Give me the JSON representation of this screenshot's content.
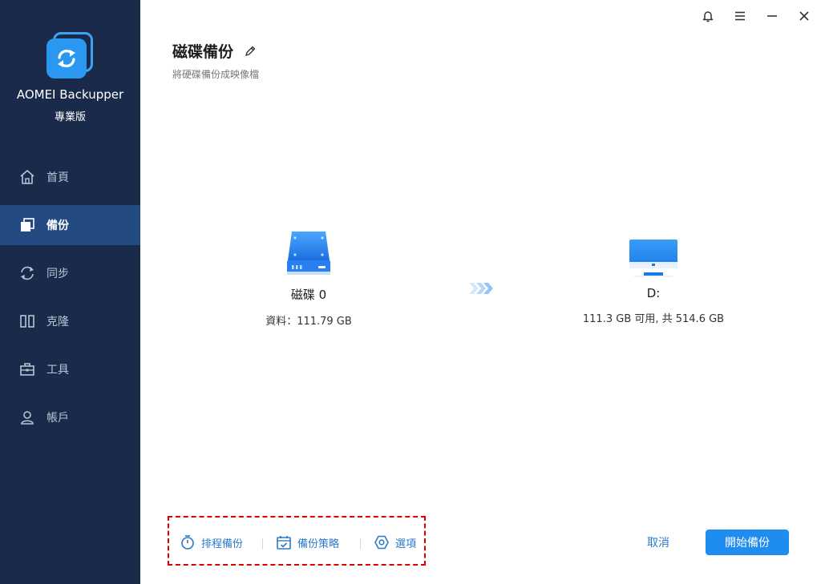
{
  "sidebar": {
    "app_name": "AOMEI Backupper",
    "edition": "專業版",
    "items": [
      {
        "label": "首頁",
        "icon": "home-icon",
        "active": false
      },
      {
        "label": "備份",
        "icon": "backup-icon",
        "active": true
      },
      {
        "label": "同步",
        "icon": "sync-icon",
        "active": false
      },
      {
        "label": "克隆",
        "icon": "clone-icon",
        "active": false
      },
      {
        "label": "工具",
        "icon": "toolbox-icon",
        "active": false
      },
      {
        "label": "帳戶",
        "icon": "user-icon",
        "active": false
      }
    ]
  },
  "window_controls": [
    "bell-icon",
    "menu-icon",
    "minimize-icon",
    "close-icon"
  ],
  "header": {
    "title": "磁碟備份",
    "subtitle": "將硬碟備份成映像檔"
  },
  "source": {
    "label": "磁碟 0",
    "info": "資料：111.79 GB",
    "icon": "disk-drive-icon"
  },
  "destination": {
    "label": "D:",
    "info": "111.3 GB 可用, 共 514.6 GB",
    "icon": "monitor-icon"
  },
  "options": {
    "schedule": "排程備份",
    "scheme": "備份策略",
    "options": "選項"
  },
  "buttons": {
    "cancel": "取消",
    "start": "開始備份"
  },
  "colors": {
    "sidebar_bg": "#1a2a4a",
    "sidebar_active": "#244a84",
    "accent": "#1f8cf0",
    "link": "#2a79c9",
    "highlight_border": "#e00000"
  }
}
